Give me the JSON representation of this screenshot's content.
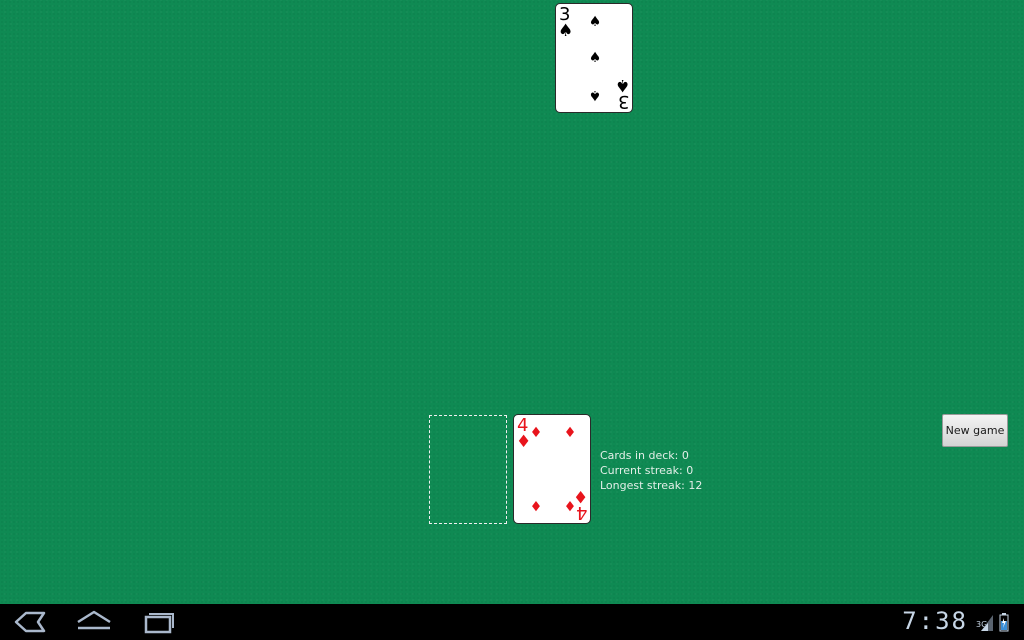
{
  "top_card": {
    "rank": "3",
    "suit": "♠",
    "color": "#000000"
  },
  "waste_card": {
    "rank": "4",
    "suit": "♦",
    "color": "#e8141c"
  },
  "stats": {
    "cards_in_deck": "Cards in deck: 0",
    "current_streak": "Current streak: 0",
    "longest_streak": "Longest streak: 12"
  },
  "buttons": {
    "new_game": "New game"
  },
  "status_bar": {
    "time": "7:38",
    "network": "3G"
  },
  "colors": {
    "felt": "#0f8a53",
    "nav_icon": "#aab8cc"
  },
  "icons": {
    "back": "back-icon",
    "home": "home-icon",
    "recent": "recent-apps-icon",
    "signal": "signal-icon",
    "battery": "battery-icon"
  }
}
